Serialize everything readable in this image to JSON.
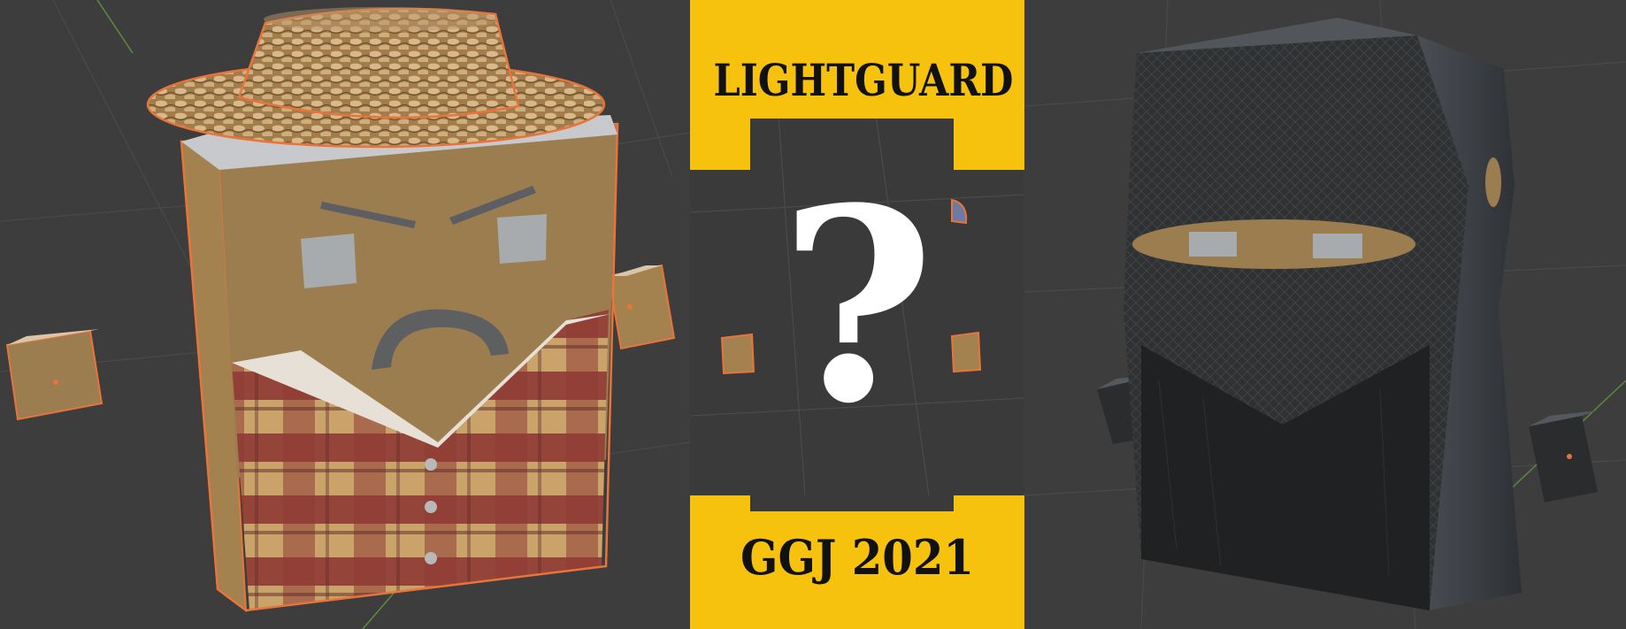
{
  "banner": {
    "title": "LIGHTGUARD",
    "subtitle": "GGJ 2021",
    "mystery_mark": "?"
  },
  "characters": [
    {
      "name": "farmer",
      "hat": "straw-hat",
      "shirt": "plaid-shirt"
    },
    {
      "name": "thief",
      "outfit": "black-hooded-mask"
    }
  ],
  "colors": {
    "banner_yellow": "#f7c20e",
    "viewport_bg": "#3d3d3d",
    "selection_outline": "#e8743b",
    "skin_tan": "#9c7d50",
    "plaid_red": "#8e3a34",
    "plaid_yellow": "#c9a36a",
    "hood_black": "#2a2c2e"
  }
}
